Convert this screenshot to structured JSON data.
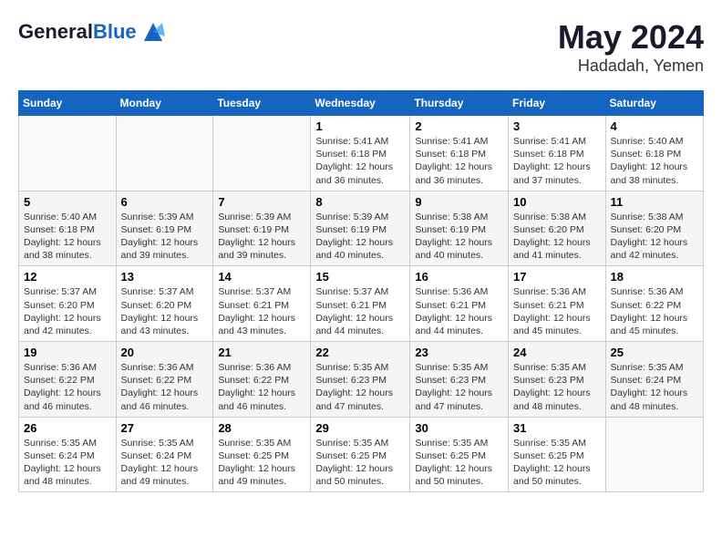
{
  "header": {
    "logo_line1": "General",
    "logo_line2": "Blue",
    "month_title": "May 2024",
    "location": "Hadadah, Yemen"
  },
  "weekdays": [
    "Sunday",
    "Monday",
    "Tuesday",
    "Wednesday",
    "Thursday",
    "Friday",
    "Saturday"
  ],
  "weeks": [
    [
      {
        "day": "",
        "info": ""
      },
      {
        "day": "",
        "info": ""
      },
      {
        "day": "",
        "info": ""
      },
      {
        "day": "1",
        "info": "Sunrise: 5:41 AM\nSunset: 6:18 PM\nDaylight: 12 hours\nand 36 minutes."
      },
      {
        "day": "2",
        "info": "Sunrise: 5:41 AM\nSunset: 6:18 PM\nDaylight: 12 hours\nand 36 minutes."
      },
      {
        "day": "3",
        "info": "Sunrise: 5:41 AM\nSunset: 6:18 PM\nDaylight: 12 hours\nand 37 minutes."
      },
      {
        "day": "4",
        "info": "Sunrise: 5:40 AM\nSunset: 6:18 PM\nDaylight: 12 hours\nand 38 minutes."
      }
    ],
    [
      {
        "day": "5",
        "info": "Sunrise: 5:40 AM\nSunset: 6:18 PM\nDaylight: 12 hours\nand 38 minutes."
      },
      {
        "day": "6",
        "info": "Sunrise: 5:39 AM\nSunset: 6:19 PM\nDaylight: 12 hours\nand 39 minutes."
      },
      {
        "day": "7",
        "info": "Sunrise: 5:39 AM\nSunset: 6:19 PM\nDaylight: 12 hours\nand 39 minutes."
      },
      {
        "day": "8",
        "info": "Sunrise: 5:39 AM\nSunset: 6:19 PM\nDaylight: 12 hours\nand 40 minutes."
      },
      {
        "day": "9",
        "info": "Sunrise: 5:38 AM\nSunset: 6:19 PM\nDaylight: 12 hours\nand 40 minutes."
      },
      {
        "day": "10",
        "info": "Sunrise: 5:38 AM\nSunset: 6:20 PM\nDaylight: 12 hours\nand 41 minutes."
      },
      {
        "day": "11",
        "info": "Sunrise: 5:38 AM\nSunset: 6:20 PM\nDaylight: 12 hours\nand 42 minutes."
      }
    ],
    [
      {
        "day": "12",
        "info": "Sunrise: 5:37 AM\nSunset: 6:20 PM\nDaylight: 12 hours\nand 42 minutes."
      },
      {
        "day": "13",
        "info": "Sunrise: 5:37 AM\nSunset: 6:20 PM\nDaylight: 12 hours\nand 43 minutes."
      },
      {
        "day": "14",
        "info": "Sunrise: 5:37 AM\nSunset: 6:21 PM\nDaylight: 12 hours\nand 43 minutes."
      },
      {
        "day": "15",
        "info": "Sunrise: 5:37 AM\nSunset: 6:21 PM\nDaylight: 12 hours\nand 44 minutes."
      },
      {
        "day": "16",
        "info": "Sunrise: 5:36 AM\nSunset: 6:21 PM\nDaylight: 12 hours\nand 44 minutes."
      },
      {
        "day": "17",
        "info": "Sunrise: 5:36 AM\nSunset: 6:21 PM\nDaylight: 12 hours\nand 45 minutes."
      },
      {
        "day": "18",
        "info": "Sunrise: 5:36 AM\nSunset: 6:22 PM\nDaylight: 12 hours\nand 45 minutes."
      }
    ],
    [
      {
        "day": "19",
        "info": "Sunrise: 5:36 AM\nSunset: 6:22 PM\nDaylight: 12 hours\nand 46 minutes."
      },
      {
        "day": "20",
        "info": "Sunrise: 5:36 AM\nSunset: 6:22 PM\nDaylight: 12 hours\nand 46 minutes."
      },
      {
        "day": "21",
        "info": "Sunrise: 5:36 AM\nSunset: 6:22 PM\nDaylight: 12 hours\nand 46 minutes."
      },
      {
        "day": "22",
        "info": "Sunrise: 5:35 AM\nSunset: 6:23 PM\nDaylight: 12 hours\nand 47 minutes."
      },
      {
        "day": "23",
        "info": "Sunrise: 5:35 AM\nSunset: 6:23 PM\nDaylight: 12 hours\nand 47 minutes."
      },
      {
        "day": "24",
        "info": "Sunrise: 5:35 AM\nSunset: 6:23 PM\nDaylight: 12 hours\nand 48 minutes."
      },
      {
        "day": "25",
        "info": "Sunrise: 5:35 AM\nSunset: 6:24 PM\nDaylight: 12 hours\nand 48 minutes."
      }
    ],
    [
      {
        "day": "26",
        "info": "Sunrise: 5:35 AM\nSunset: 6:24 PM\nDaylight: 12 hours\nand 48 minutes."
      },
      {
        "day": "27",
        "info": "Sunrise: 5:35 AM\nSunset: 6:24 PM\nDaylight: 12 hours\nand 49 minutes."
      },
      {
        "day": "28",
        "info": "Sunrise: 5:35 AM\nSunset: 6:25 PM\nDaylight: 12 hours\nand 49 minutes."
      },
      {
        "day": "29",
        "info": "Sunrise: 5:35 AM\nSunset: 6:25 PM\nDaylight: 12 hours\nand 50 minutes."
      },
      {
        "day": "30",
        "info": "Sunrise: 5:35 AM\nSunset: 6:25 PM\nDaylight: 12 hours\nand 50 minutes."
      },
      {
        "day": "31",
        "info": "Sunrise: 5:35 AM\nSunset: 6:25 PM\nDaylight: 12 hours\nand 50 minutes."
      },
      {
        "day": "",
        "info": ""
      }
    ]
  ]
}
